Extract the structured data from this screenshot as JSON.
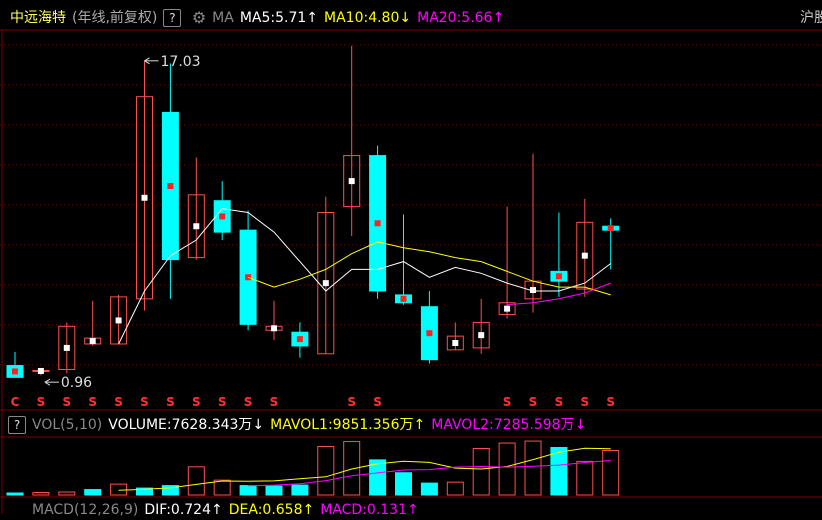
{
  "header": {
    "stock_name": "中远海特",
    "period": "(年线,前复权)",
    "help": "?",
    "ma_label": "MA",
    "ma5": "MA5:5.71",
    "ma5_arrow": "↑",
    "ma10": "MA10:4.80",
    "ma10_arrow": "↓",
    "ma20": "MA20:5.66",
    "ma20_arrow": "↑",
    "market": "沪股"
  },
  "vol_header": {
    "help": "?",
    "label": "VOL(5,10)",
    "volume": "VOLUME:7628.343万",
    "volume_arrow": "↓",
    "mavol1": "MAVOL1:9851.356万",
    "mavol1_arrow": "↑",
    "mavol2": "MAVOL2:7285.598万",
    "mavol2_arrow": "↓"
  },
  "macd_header": {
    "label": "MACD(12,26,9)",
    "dif": "DIF:0.724",
    "dif_arrow": "↑",
    "dea": "DEA:0.658",
    "dea_arrow": "↑",
    "macd": "MACD:0.131",
    "macd_arrow": "↑"
  },
  "colors": {
    "up": "#ff5050",
    "down": "#00ffff",
    "ma5": "#ffffff",
    "ma10": "#ffff00",
    "ma20": "#ff00ff",
    "grid": "#7a0000"
  },
  "chart_data": {
    "type": "candlestick",
    "price_range": [
      0,
      17.03
    ],
    "annotations": {
      "high": "17.03",
      "low": "0.96"
    },
    "candles": [
      {
        "o": 1.5,
        "h": 2.2,
        "l": 0.9,
        "c": 0.9
      },
      {
        "o": 1.2,
        "h": 1.35,
        "l": 1.0,
        "c": 1.25
      },
      {
        "o": 1.3,
        "h": 3.7,
        "l": 1.1,
        "c": 3.5
      },
      {
        "o": 2.6,
        "h": 4.8,
        "l": 2.5,
        "c": 2.9
      },
      {
        "o": 2.6,
        "h": 5.1,
        "l": 2.6,
        "c": 5.0
      },
      {
        "o": 4.9,
        "h": 17.03,
        "l": 4.3,
        "c": 15.2
      },
      {
        "o": 14.4,
        "h": 16.9,
        "l": 4.9,
        "c": 6.9
      },
      {
        "o": 7.0,
        "h": 12.1,
        "l": 6.9,
        "c": 10.2
      },
      {
        "o": 9.9,
        "h": 10.9,
        "l": 7.9,
        "c": 8.3
      },
      {
        "o": 8.4,
        "h": 9.4,
        "l": 3.3,
        "c": 3.6
      },
      {
        "o": 3.3,
        "h": 4.8,
        "l": 2.8,
        "c": 3.5
      },
      {
        "o": 3.2,
        "h": 3.7,
        "l": 1.9,
        "c": 2.5
      },
      {
        "o": 2.1,
        "h": 10.1,
        "l": 2.1,
        "c": 9.3
      },
      {
        "o": 9.6,
        "h": 17.8,
        "l": 8.1,
        "c": 12.2
      },
      {
        "o": 12.2,
        "h": 12.7,
        "l": 4.9,
        "c": 5.3
      },
      {
        "o": 5.1,
        "h": 9.2,
        "l": 4.6,
        "c": 4.7
      },
      {
        "o": 4.5,
        "h": 5.3,
        "l": 1.6,
        "c": 1.8
      },
      {
        "o": 2.3,
        "h": 3.7,
        "l": 2.3,
        "c": 3.0
      },
      {
        "o": 2.4,
        "h": 4.9,
        "l": 2.1,
        "c": 3.7
      },
      {
        "o": 4.1,
        "h": 9.6,
        "l": 3.9,
        "c": 4.7
      },
      {
        "o": 4.9,
        "h": 12.3,
        "l": 4.2,
        "c": 5.8
      },
      {
        "o": 6.3,
        "h": 9.3,
        "l": 5.0,
        "c": 5.8
      },
      {
        "o": 5.4,
        "h": 10.0,
        "l": 5.0,
        "c": 8.8
      },
      {
        "o": 8.6,
        "h": 9.0,
        "l": 6.4,
        "c": 8.4
      }
    ],
    "ma5": [
      null,
      null,
      null,
      null,
      2.6,
      5.3,
      7.1,
      7.9,
      9.5,
      9.3,
      8.3,
      6.8,
      5.3,
      6.4,
      6.4,
      6.8,
      6.0,
      6.5,
      6.2,
      5.7,
      5.3,
      5.3,
      5.7,
      6.7
    ],
    "ma10": [
      null,
      null,
      null,
      null,
      null,
      null,
      null,
      null,
      null,
      6.0,
      5.5,
      5.9,
      6.4,
      7.2,
      7.8,
      7.5,
      7.3,
      7.0,
      6.8,
      6.3,
      5.8,
      5.5,
      5.5,
      5.1
    ],
    "ma20": [
      null,
      null,
      null,
      null,
      null,
      null,
      null,
      null,
      null,
      null,
      null,
      null,
      null,
      null,
      null,
      null,
      null,
      null,
      null,
      4.6,
      4.7,
      4.9,
      5.2,
      5.7
    ],
    "volume": [
      20,
      25,
      30,
      55,
      110,
      70,
      95,
      285,
      150,
      95,
      90,
      100,
      490,
      540,
      355,
      225,
      120,
      130,
      470,
      525,
      545,
      480,
      340,
      450
    ],
    "volume_up": [
      false,
      true,
      true,
      false,
      true,
      false,
      false,
      true,
      true,
      false,
      false,
      false,
      true,
      true,
      false,
      false,
      false,
      true,
      true,
      true,
      true,
      false,
      true,
      true
    ],
    "mavol1": [
      null,
      null,
      null,
      null,
      48,
      58,
      72,
      107,
      142,
      139,
      143,
      164,
      184,
      263,
      315,
      342,
      329,
      272,
      263,
      288,
      358,
      433,
      472,
      468
    ],
    "mavol2": [
      null,
      null,
      null,
      null,
      null,
      null,
      null,
      null,
      null,
      93,
      100,
      113,
      146,
      194,
      223,
      253,
      257,
      282,
      288,
      282,
      290,
      302,
      328,
      349
    ],
    "s_markers": [
      "C",
      "S",
      "S",
      "S",
      "S",
      "S",
      "S",
      "S",
      "S",
      "S",
      "S",
      "",
      "",
      "S",
      "S",
      "",
      "",
      "",
      "",
      "S",
      "S",
      "S",
      "S",
      "S"
    ]
  }
}
